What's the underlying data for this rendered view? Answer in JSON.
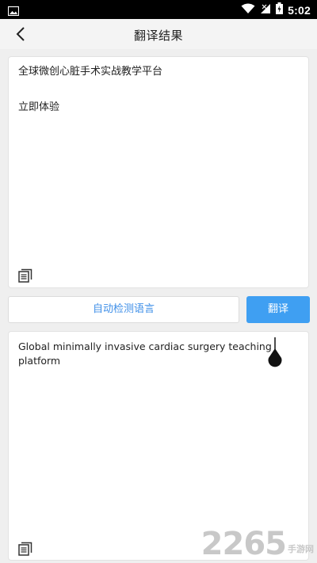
{
  "status_bar": {
    "time": "5:02",
    "icons": [
      "image-icon",
      "wifi-icon",
      "signal-icon",
      "battery-charging-icon"
    ]
  },
  "header": {
    "title": "翻译结果"
  },
  "source": {
    "lines": [
      "全球微创心脏手术实战教学平台",
      "立即体验"
    ]
  },
  "controls": {
    "detect_label": "自动检测语言",
    "translate_label": "翻译"
  },
  "result": {
    "text": "Global minimally invasive cardiac surgery teaching platform"
  },
  "watermark": {
    "number": "2265",
    "site": "手游网"
  },
  "colors": {
    "accent": "#3f9ff2",
    "link": "#3f8fe8",
    "background": "#efefef"
  }
}
